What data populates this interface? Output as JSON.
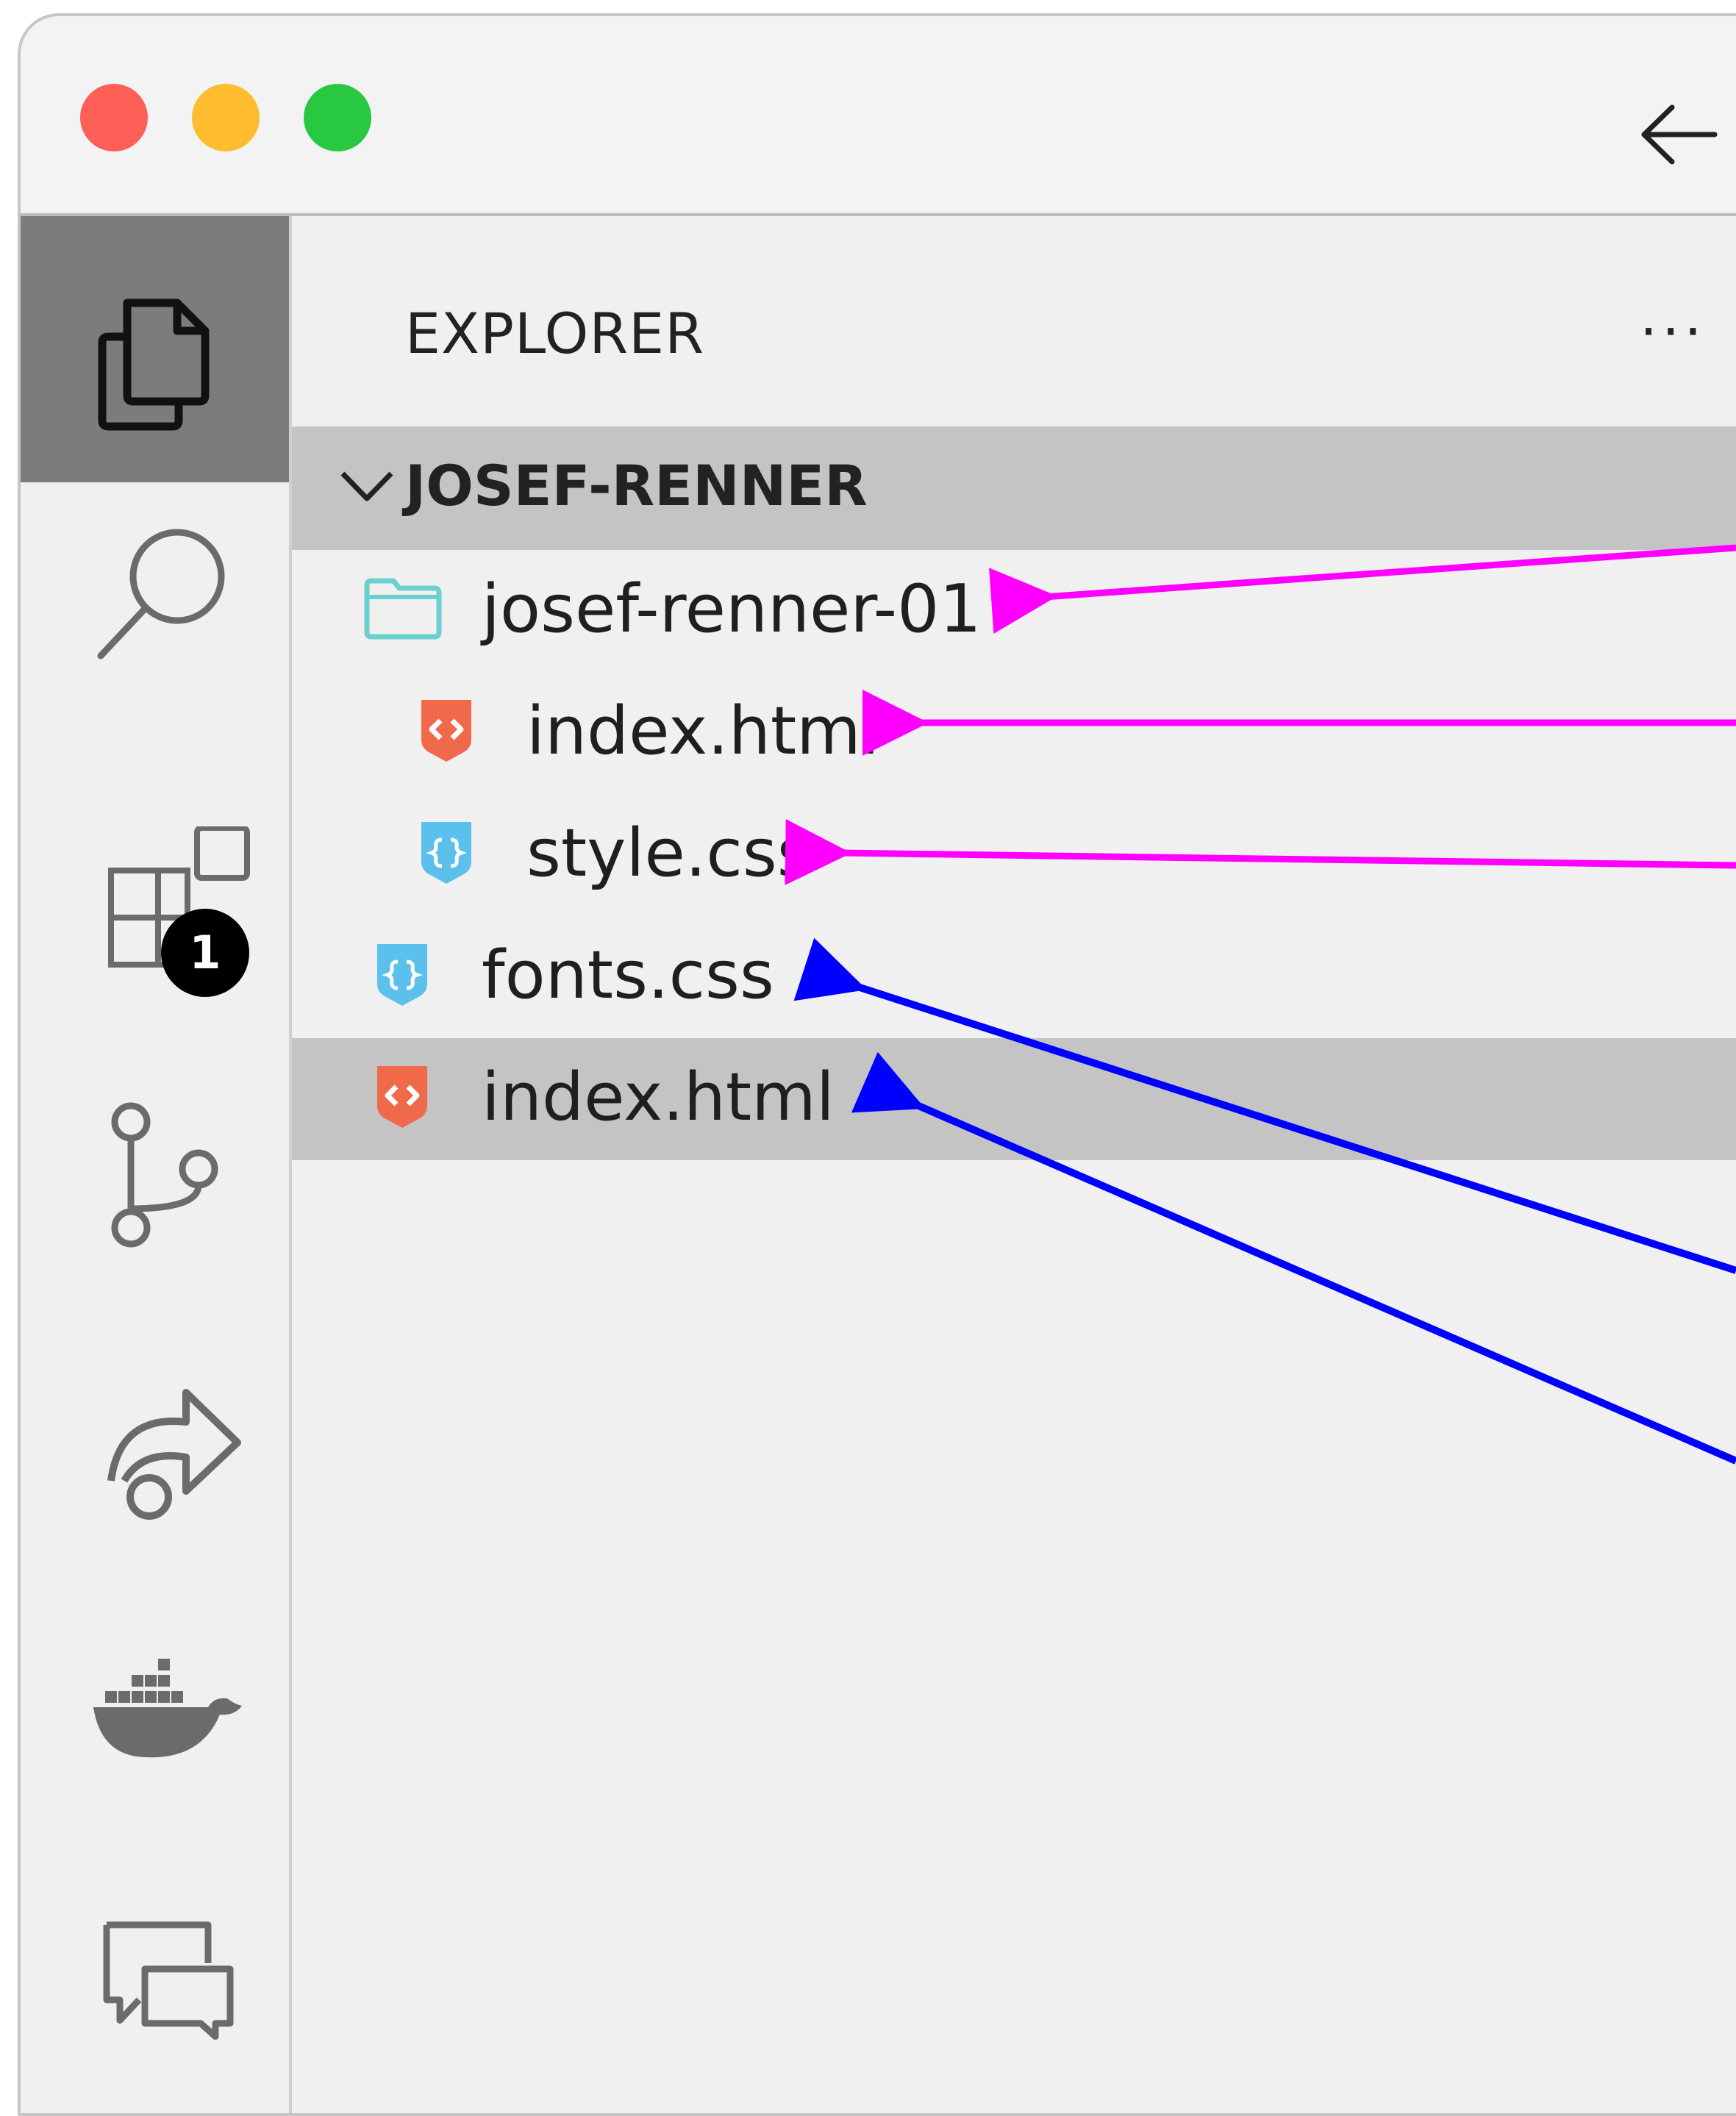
{
  "window": {
    "traffic_lights": [
      "close",
      "minimize",
      "zoom"
    ],
    "back_icon": "arrow-left-icon"
  },
  "activity_bar": {
    "items": [
      {
        "name": "explorer",
        "icon": "files-icon",
        "active": true
      },
      {
        "name": "search",
        "icon": "search-icon"
      },
      {
        "name": "extensions",
        "icon": "extensions-icon",
        "badge": "1"
      },
      {
        "name": "source-control",
        "icon": "source-control-icon"
      },
      {
        "name": "live-share",
        "icon": "live-share-icon"
      },
      {
        "name": "docker",
        "icon": "docker-icon"
      },
      {
        "name": "comments",
        "icon": "comments-icon"
      }
    ]
  },
  "explorer": {
    "title": "EXPLORER",
    "more": "···",
    "root_folder": "JOSEF-RENNER",
    "tree": [
      {
        "label": "josef-renner-01",
        "type": "folder",
        "icon": "folder-icon"
      },
      {
        "label": "index.html",
        "type": "html",
        "icon": "html-file-icon"
      },
      {
        "label": "style.css",
        "type": "css",
        "icon": "css-file-icon"
      },
      {
        "label": "fonts.css",
        "type": "css",
        "icon": "css-file-icon"
      },
      {
        "label": "index.html",
        "type": "html",
        "icon": "html-file-icon",
        "selected": true
      }
    ]
  },
  "colors": {
    "annotation_magenta": "#ff00ff",
    "annotation_blue": "#0000ff",
    "html_icon": "#f0694a",
    "css_icon": "#5bc0eb",
    "folder_icon": "#6ccfd0"
  }
}
